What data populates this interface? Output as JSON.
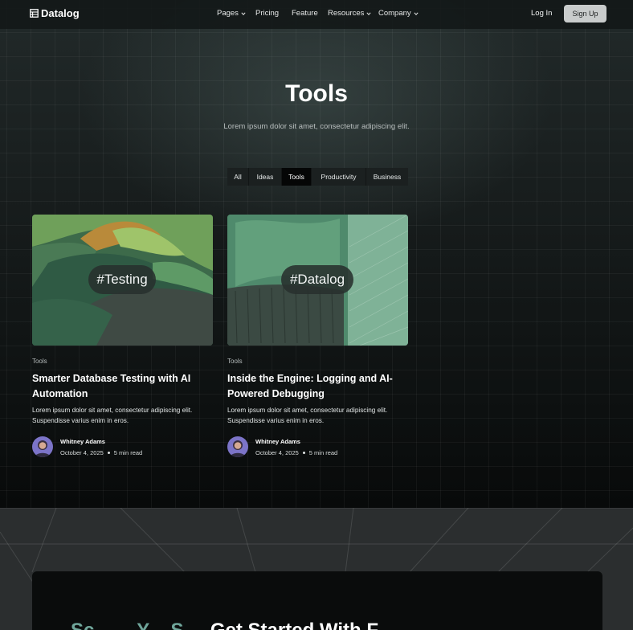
{
  "nav": {
    "logo": "Datalog",
    "links": [
      {
        "label": "Pages",
        "dropdown": true
      },
      {
        "label": "Pricing",
        "dropdown": false
      },
      {
        "label": "Feature",
        "dropdown": false
      },
      {
        "label": "Resources",
        "dropdown": true
      },
      {
        "label": "Company",
        "dropdown": true
      }
    ],
    "login": "Log In",
    "signup": "Sign Up"
  },
  "header": {
    "title": "Tools",
    "subtitle": "Lorem ipsum dolor sit amet, consectetur adipiscing elit."
  },
  "tabs": [
    {
      "label": "All",
      "active": false
    },
    {
      "label": "Ideas",
      "active": false
    },
    {
      "label": "Tools",
      "active": true
    },
    {
      "label": "Productivity",
      "active": false
    },
    {
      "label": "Business",
      "active": false
    }
  ],
  "posts": [
    {
      "tag": "#Testing",
      "category": "Tools",
      "title": "Smarter Database Testing with AI Automation",
      "excerpt": "Lorem ipsum dolor sit amet, consectetur adipiscing elit. Suspendisse varius enim in eros.",
      "author": "Whitney Adams",
      "date": "October 4, 2025",
      "read_time": "5 min read"
    },
    {
      "tag": "#Datalog",
      "category": "Tools",
      "title": "Inside the Engine: Logging and AI-Powered Debugging",
      "excerpt": "Lorem ipsum dolor sit amet, consectetur adipiscing elit. Suspendisse varius enim in eros.",
      "author": "Whitney Adams",
      "date": "October 4, 2025",
      "read_time": "5 min read"
    }
  ],
  "cta": {
    "part1": "S",
    "accent": "c        Y    S",
    "part2": "     Get Started With F"
  },
  "colors": {
    "accent": "#6fa59a",
    "background": "#0b0d0d",
    "signup_button": "#c9cccc"
  }
}
